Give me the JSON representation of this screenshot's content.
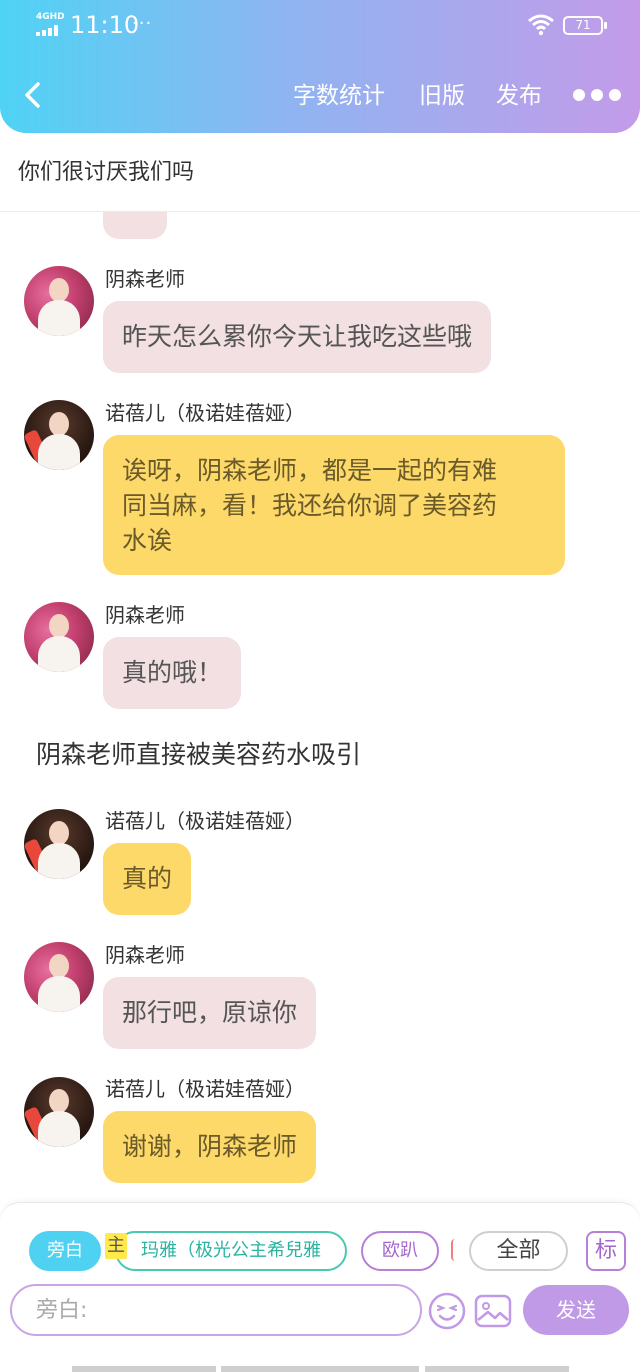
{
  "status_bar": {
    "network": "4GHD",
    "time": "11:10",
    "extra": "···",
    "battery": "71"
  },
  "nav": {
    "word_count": "字数统计",
    "old_version": "旧版",
    "publish": "发布"
  },
  "doc_title": "你们很讨厌我们吗",
  "messages": [
    {
      "speaker": "阴森老师",
      "text": "昨天怎么累你今天让我吃这些哦",
      "color": "pink"
    },
    {
      "speaker": "诺蓓儿（极诺娃蓓娅）",
      "text_lines": [
        "诶呀，阴森老师，都是一起的有难",
        "同当麻，看！我还给你调了美容药",
        "水诶"
      ],
      "color": "yellow"
    },
    {
      "speaker": "阴森老师",
      "text": "真的哦！",
      "color": "pink"
    },
    {
      "speaker": "诺蓓儿（极诺娃蓓娅）",
      "text": "真的",
      "color": "yellow"
    },
    {
      "speaker": "阴森老师",
      "text": "那行吧，原谅你",
      "color": "pink"
    },
    {
      "speaker": "诺蓓儿（极诺娃蓓娅）",
      "text": "谢谢，阴森老师",
      "color": "yellow"
    }
  ],
  "narration": "阴森老师直接被美容药水吸引",
  "roles": {
    "narrator": "旁白",
    "main_tag": "主",
    "maya": "玛雅（极光公主希兒雅",
    "oupa": "欧趴",
    "all": "全部",
    "mark": "标"
  },
  "input": {
    "placeholder": "旁白:",
    "send": "发送"
  },
  "colors": {
    "header_start": "#4fd3f4",
    "header_end": "#c39be9",
    "bubble_pink": "#f2e0e2",
    "bubble_yellow": "#fdd96a",
    "send": "#c09ae6"
  }
}
